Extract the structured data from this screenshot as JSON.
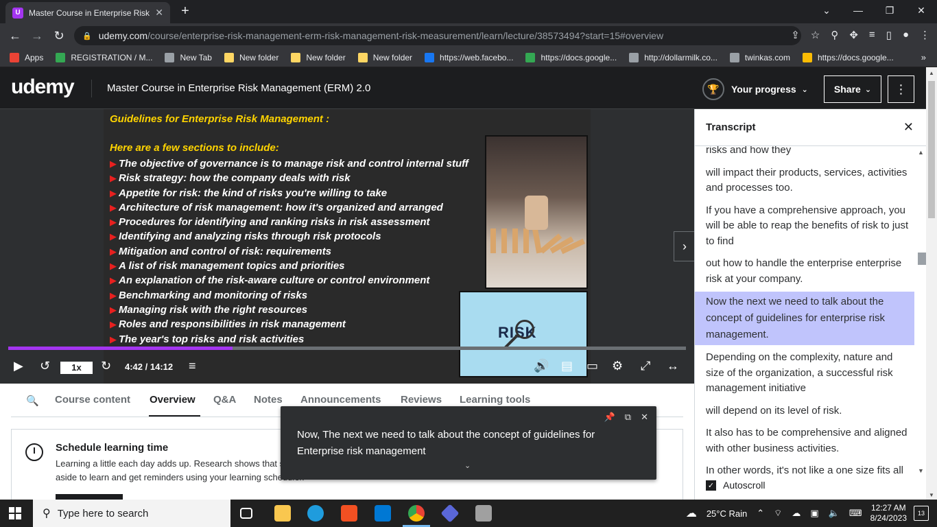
{
  "browser": {
    "tab_title": "Master Course in Enterprise Risk",
    "tab_favicon": "udemy-favicon",
    "url_host": "udemy.com",
    "url_path": "/course/enterprise-risk-management-erm-risk-management-risk-measurement/learn/lecture/38573494?start=15#overview"
  },
  "bookmarks": [
    {
      "label": "Apps",
      "color": "#ea4335"
    },
    {
      "label": "REGISTRATION / M...",
      "color": "#34a853"
    },
    {
      "label": "New Tab",
      "color": "#9aa0a6"
    },
    {
      "label": "New folder",
      "color": "#fdd663"
    },
    {
      "label": "New folder",
      "color": "#fdd663"
    },
    {
      "label": "New folder",
      "color": "#fdd663"
    },
    {
      "label": "https://web.facebo...",
      "color": "#1877f2"
    },
    {
      "label": "https://docs.google...",
      "color": "#34a853"
    },
    {
      "label": "http://dollarmilk.co...",
      "color": "#9aa0a6"
    },
    {
      "label": "twinkas.com",
      "color": "#9aa0a6"
    },
    {
      "label": "https://docs.google...",
      "color": "#fbbc04"
    }
  ],
  "header": {
    "logo": "udemy",
    "course_title": "Master Course in Enterprise Risk Management (ERM) 2.0",
    "progress_label": "Your progress",
    "share_label": "Share"
  },
  "slide": {
    "heading": "Guidelines for Enterprise Risk Management :",
    "subheading": "Here are a few sections to include:",
    "items": [
      "The objective of governance is to manage risk and control internal stuff",
      "Risk strategy: how the company deals with risk",
      "Appetite for risk: the kind of risks you're willing to take",
      "Architecture of risk management: how it's organized and arranged",
      "Procedures for identifying and ranking risks in risk assessment",
      "Identifying and analyzing risks through risk protocols",
      "Mitigation and control of risk: requirements",
      "A list of risk management topics and priorities",
      "An explanation of the risk-aware culture or control environment",
      "Benchmarking and monitoring of risks",
      "Managing risk with the right resources",
      "Roles and responsibilities in risk management",
      "The year's top risks and risk activities"
    ],
    "image2_text": "RISK"
  },
  "player": {
    "speed": "1x",
    "time": "4:42 / 14:12",
    "progress_fraction": 0.331
  },
  "transcript": {
    "title": "Transcript",
    "cues": [
      "risks and how they",
      "will impact their products, services, activities and processes too.",
      "If you have a comprehensive approach, you will be able to reap the benefits of risk to just to find",
      "out how to handle the enterprise enterprise risk at your company.",
      "Now the next we need to talk about the concept of guidelines for enterprise risk management.",
      "Depending on the complexity, nature and size of the organization, a successful risk management initiative",
      "will depend on its level of risk.",
      "It also has to be comprehensive and aligned with other business activities.",
      "In other words, it's not like a one size fits all service"
    ],
    "active_index": 4,
    "autoscroll_label": "Autoscroll"
  },
  "course_tabs": [
    "Course content",
    "Overview",
    "Q&A",
    "Notes",
    "Announcements",
    "Reviews",
    "Learning tools"
  ],
  "active_tab": "Overview",
  "schedule": {
    "title": "Schedule learning time",
    "text": "Learning a little each day adds up. Research shows that students who make learning a habit are more likely to reach their goals. Set time aside to learn and get reminders using your learning scheduler."
  },
  "caption": {
    "text": "Now, The next we need to talk about the concept of guidelines for Enterprise risk management"
  },
  "taskbar": {
    "search_placeholder": "Type here to search",
    "weather": "25°C  Rain",
    "time": "12:27 AM",
    "date": "8/24/2023",
    "notification_count": "13"
  }
}
